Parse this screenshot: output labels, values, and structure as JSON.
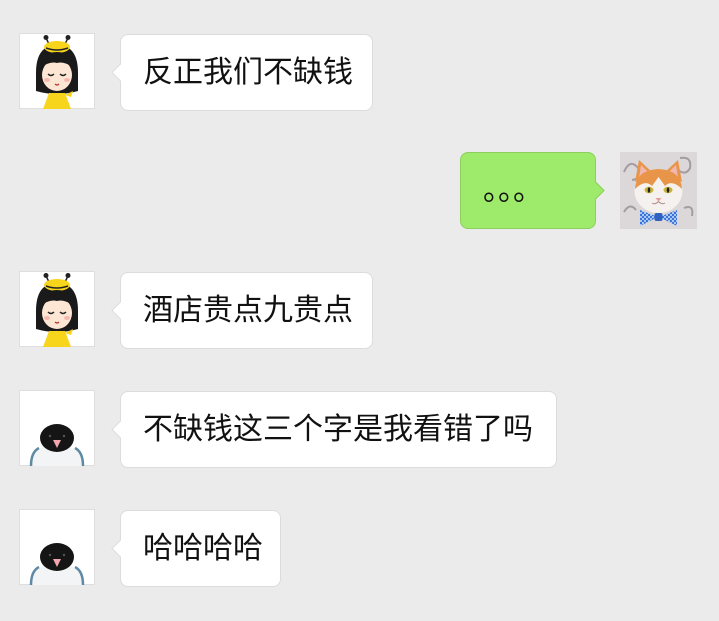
{
  "colors": {
    "background": "#ebebeb",
    "incoming_bubble": "#ffffff",
    "outgoing_bubble": "#9eea6a",
    "text": "#111111"
  },
  "chat": {
    "messages": [
      {
        "side": "left",
        "avatar": "girl-bee-hat-avatar",
        "text": "反正我们不缺钱"
      },
      {
        "side": "right",
        "avatar": "cat-bowtie-avatar",
        "text": "。。。"
      },
      {
        "side": "left",
        "avatar": "girl-bee-hat-avatar",
        "text": "酒店贵点九贵点"
      },
      {
        "side": "left",
        "avatar": "penguin-bird-avatar",
        "text": "不缺钱这三个字是我看错了吗"
      },
      {
        "side": "left",
        "avatar": "penguin-bird-avatar",
        "text": "哈哈哈哈"
      }
    ]
  }
}
